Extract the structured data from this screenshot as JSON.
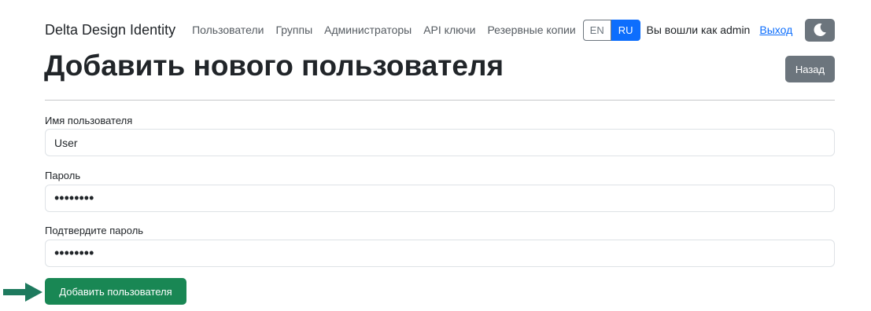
{
  "navbar": {
    "brand": "Delta Design Identity",
    "links": [
      "Пользователи",
      "Группы",
      "Администраторы",
      "API ключи",
      "Резервные копии"
    ],
    "lang_en": "EN",
    "lang_ru": "RU",
    "logged_in_text": "Вы вошли как admin",
    "logout": "Выход",
    "theme_icon": "moon-icon"
  },
  "header": {
    "title": "Добавить нового пользователя",
    "back_button": "Назад"
  },
  "form": {
    "username_label": "Имя пользователя",
    "username_value": "User",
    "password_label": "Пароль",
    "password_value": "••••••••",
    "confirm_label": "Подтвердите пароль",
    "confirm_value": "••••••••",
    "submit_label": "Добавить пользователя"
  },
  "colors": {
    "primary": "#0d6efd",
    "secondary": "#6c757d",
    "success": "#198754",
    "arrow": "#1e7a5e"
  }
}
